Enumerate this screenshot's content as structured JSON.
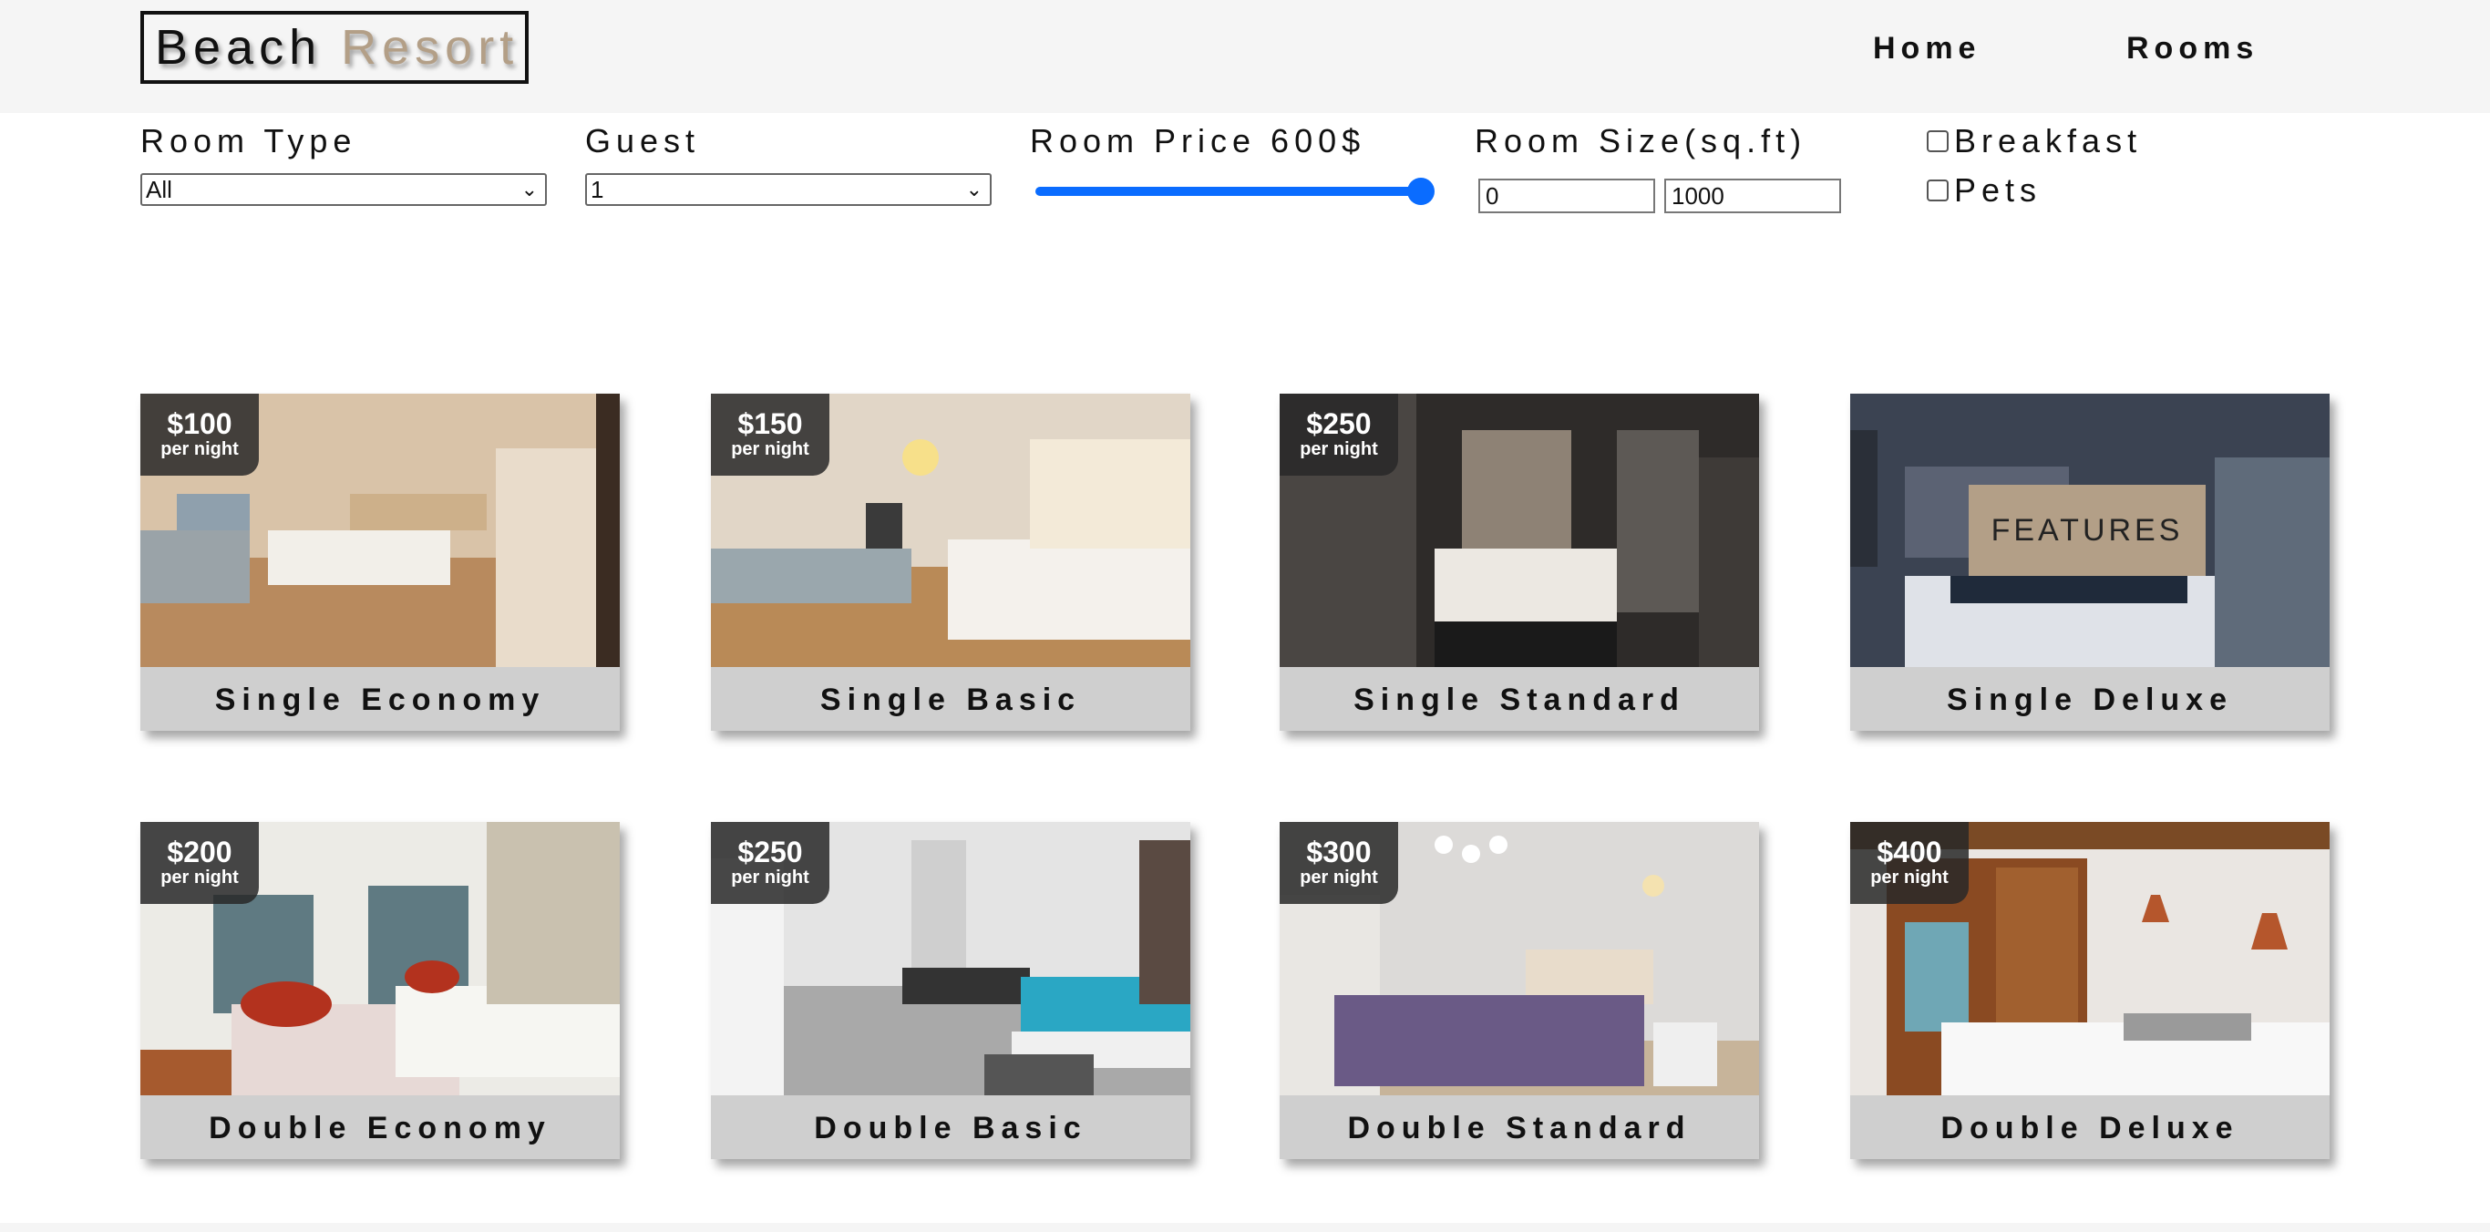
{
  "brand": {
    "word1": "Beach",
    "word2": "Resort",
    "accent_color": "#b39f87"
  },
  "nav": {
    "home": "Home",
    "rooms": "Rooms"
  },
  "filters": {
    "room_type_label": "Room Type",
    "room_type_value": "All",
    "guest_label": "Guest",
    "guest_value": "1",
    "price_label": "Room Price 600$",
    "price_value": 600,
    "price_fraction": 1.0,
    "size_label": "Room Size(sq.ft)",
    "size_min": "0",
    "size_max": "1000",
    "breakfast_label": "Breakfast",
    "pets_label": "Pets",
    "slider_color": "#0a6cff"
  },
  "rooms": [
    {
      "price": "$100",
      "per": "per night",
      "name": "Single Economy"
    },
    {
      "price": "$150",
      "per": "per night",
      "name": "Single Basic"
    },
    {
      "price": "$250",
      "per": "per night",
      "name": "Single Standard"
    },
    {
      "price": "",
      "per": "",
      "name": "Single Deluxe",
      "hover_label": "FEATURES"
    },
    {
      "price": "$200",
      "per": "per night",
      "name": "Double Economy"
    },
    {
      "price": "$250",
      "per": "per night",
      "name": "Double Basic"
    },
    {
      "price": "$300",
      "per": "per night",
      "name": "Double Standard"
    },
    {
      "price": "$400",
      "per": "per night",
      "name": "Double Deluxe"
    }
  ]
}
